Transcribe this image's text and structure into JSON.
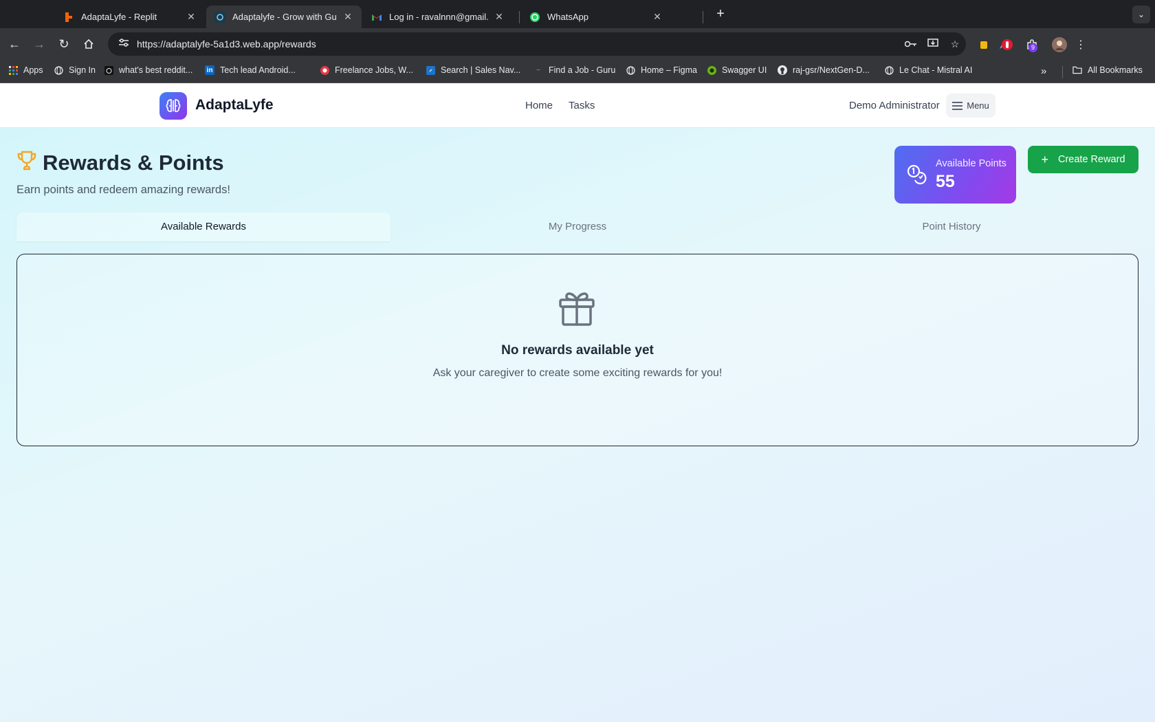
{
  "browser": {
    "tabs": [
      {
        "title": "AdaptaLyfe - Replit",
        "favicon": "replit-icon"
      },
      {
        "title": "Adaptalyfe - Grow with Guida",
        "favicon": "adaptalyfe-icon",
        "active": true
      },
      {
        "title": "Log in - ravalnnn@gmail.com",
        "favicon": "gmail-icon"
      },
      {
        "title": "WhatsApp",
        "favicon": "whatsapp-icon"
      }
    ],
    "url": "https://adaptalyfe-5a1d3.web.app/rewards",
    "extension_badge": "9",
    "bookmarks": [
      "Apps",
      "Sign In",
      "what's best reddit...",
      "Tech lead Android...",
      "Freelance Jobs, W...",
      "Search | Sales Nav...",
      "Find a Job - Guru",
      "Home – Figma",
      "Swagger UI",
      "raj-gsr/NextGen-D...",
      "Le Chat - Mistral AI"
    ],
    "overflow": "»",
    "all_bookmarks": "All Bookmarks"
  },
  "app": {
    "brand": "AdaptaLyfe",
    "nav": {
      "home": "Home",
      "tasks": "Tasks"
    },
    "user": "Demo Administrator",
    "menu": "Menu",
    "page": {
      "title": "Rewards & Points",
      "subtitle": "Earn points and redeem amazing rewards!"
    },
    "points": {
      "label": "Available Points",
      "value": "55"
    },
    "create_reward": "Create Reward",
    "tabs": [
      "Available Rewards",
      "My Progress",
      "Point History"
    ],
    "empty": {
      "title": "No rewards available yet",
      "text": "Ask your caregiver to create some exciting rewards for you!"
    }
  },
  "colors": {
    "accent_green": "#16a34a",
    "points_gradient_start": "#4f6ef0",
    "points_gradient_end": "#a43ae6",
    "trophy": "#f5a524"
  }
}
